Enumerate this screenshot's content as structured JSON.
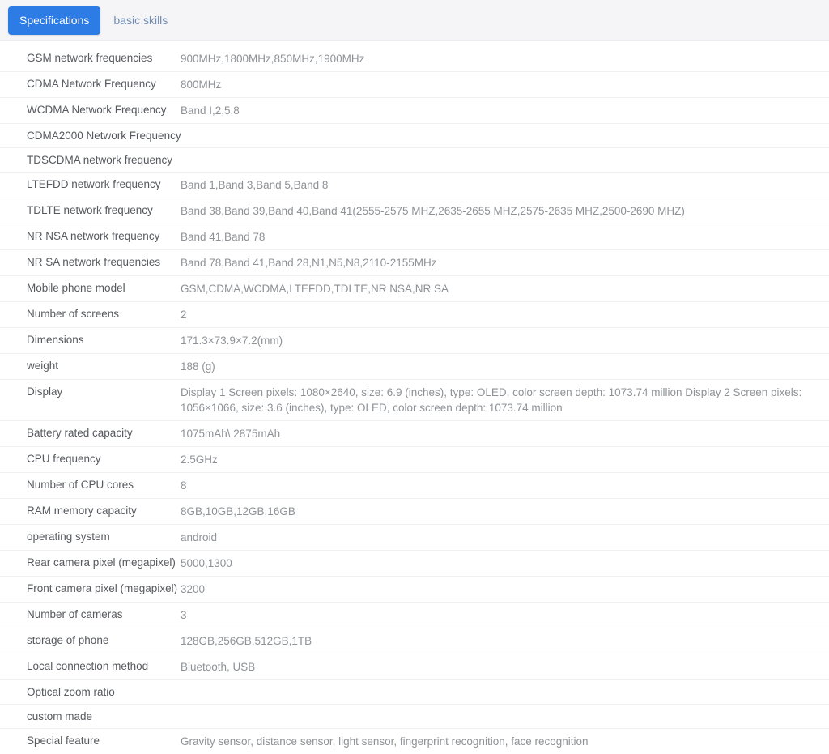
{
  "tabs": [
    {
      "label": "Specifications",
      "active": true
    },
    {
      "label": "basic skills",
      "active": false
    }
  ],
  "colors": {
    "tab_active_bg": "#2d7ce5",
    "tab_active_text": "#ffffff",
    "tab_inactive_text": "#6e8cb4",
    "tabbar_bg": "#f5f5f7",
    "label_text": "#56595e",
    "value_text": "#8e9296",
    "row_divider": "#f1f1f2",
    "page_bg": "#ffffff"
  },
  "spec_rows": [
    {
      "label": "GSM network frequencies",
      "value": "900MHz,1800MHz,850MHz,1900MHz"
    },
    {
      "label": "CDMA Network Frequency",
      "value": "800MHz"
    },
    {
      "label": "WCDMA Network Frequency",
      "value": "Band I,2,5,8"
    },
    {
      "label": "CDMA2000 Network Frequency",
      "value": ""
    },
    {
      "label": "TDSCDMA network frequency",
      "value": ""
    },
    {
      "label": "LTEFDD network frequency",
      "value": "Band 1,Band 3,Band 5,Band 8"
    },
    {
      "label": "TDLTE network frequency",
      "value": "Band 38,Band 39,Band 40,Band 41(2555-2575 MHZ,2635-2655 MHZ,2575-2635 MHZ,2500-2690 MHZ)"
    },
    {
      "label": "NR NSA network frequency",
      "value": "Band 41,Band 78"
    },
    {
      "label": "NR SA network frequencies",
      "value": "Band 78,Band 41,Band 28,N1,N5,N8,2110-2155MHz"
    },
    {
      "label": "Mobile phone model",
      "value": "GSM,CDMA,WCDMA,LTEFDD,TDLTE,NR NSA,NR SA"
    },
    {
      "label": "Number of screens",
      "value": "2"
    },
    {
      "label": "Dimensions",
      "value": "171.3×73.9×7.2(mm)"
    },
    {
      "label": "weight",
      "value": "188 (g)"
    },
    {
      "label": "Display",
      "value": "Display 1 Screen pixels: 1080×2640, size: 6.9 (inches), type: OLED, color screen depth: 1073.74 million Display 2 Screen pixels: 1056×1066, size: 3.6 (inches), type: OLED, color screen depth: 1073.74 million"
    },
    {
      "label": "Battery rated capacity",
      "value": "1075mAh\\ 2875mAh"
    },
    {
      "label": "CPU frequency",
      "value": "2.5GHz"
    },
    {
      "label": "Number of CPU cores",
      "value": "8"
    },
    {
      "label": "RAM memory capacity",
      "value": "8GB,10GB,12GB,16GB"
    },
    {
      "label": "operating system",
      "value": "android"
    },
    {
      "label": "Rear camera pixel (megapixel)",
      "value": "5000,1300"
    },
    {
      "label": "Front camera pixel (megapixel)",
      "value": "3200"
    },
    {
      "label": "Number of cameras",
      "value": "3"
    },
    {
      "label": "storage of phone",
      "value": "128GB,256GB,512GB,1TB"
    },
    {
      "label": "Local connection method",
      "value": "Bluetooth, USB"
    },
    {
      "label": "Optical zoom ratio",
      "value": ""
    },
    {
      "label": "custom made",
      "value": ""
    },
    {
      "label": "Special feature",
      "value": "Gravity sensor, distance sensor, light sensor, fingerprint recognition, face recognition"
    }
  ]
}
